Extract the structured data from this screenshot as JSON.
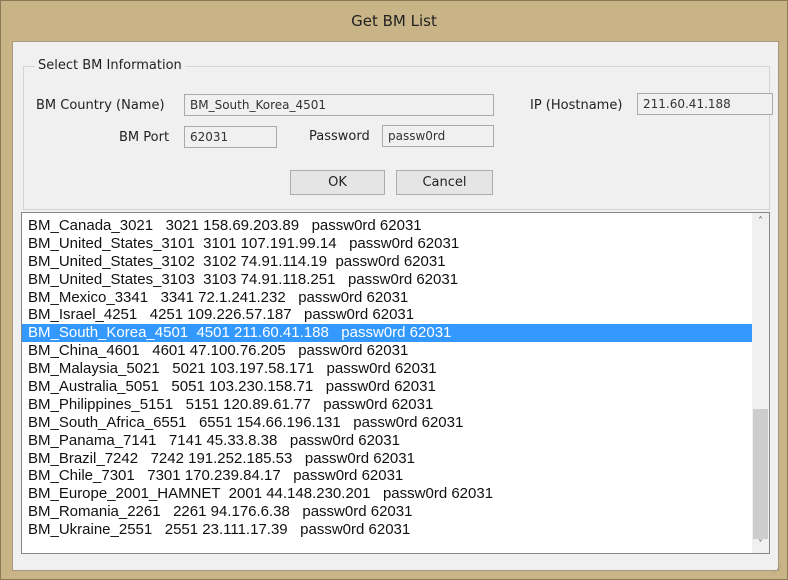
{
  "window": {
    "title": "Get BM List"
  },
  "form": {
    "group_title": "Select BM Information",
    "country_label": "BM Country (Name)",
    "country_value": "BM_South_Korea_4501",
    "ip_label": "IP (Hostname)",
    "ip_value": "211.60.41.188",
    "port_label": "BM Port",
    "port_value": "62031",
    "password_label": "Password",
    "password_value": "passw0rd",
    "ok_label": "OK",
    "cancel_label": "Cancel"
  },
  "list": {
    "selected_index": 6,
    "rows": [
      "BM_Canada_3021   3021 158.69.203.89   passw0rd 62031",
      "BM_United_States_3101  3101 107.191.99.14   passw0rd 62031",
      "BM_United_States_3102  3102 74.91.114.19  passw0rd 62031",
      "BM_United_States_3103  3103 74.91.118.251   passw0rd 62031",
      "BM_Mexico_3341   3341 72.1.241.232   passw0rd 62031",
      "BM_Israel_4251   4251 109.226.57.187   passw0rd 62031",
      "BM_South_Korea_4501  4501 211.60.41.188   passw0rd 62031",
      "BM_China_4601   4601 47.100.76.205   passw0rd 62031",
      "BM_Malaysia_5021   5021 103.197.58.171   passw0rd 62031",
      "BM_Australia_5051   5051 103.230.158.71   passw0rd 62031",
      "BM_Philippines_5151   5151 120.89.61.77   passw0rd 62031",
      "BM_South_Africa_6551   6551 154.66.196.131   passw0rd 62031",
      "BM_Panama_7141   7141 45.33.8.38   passw0rd 62031",
      "BM_Brazil_7242   7242 191.252.185.53   passw0rd 62031",
      "BM_Chile_7301   7301 170.239.84.17   passw0rd 62031",
      "BM_Europe_2001_HAMNET  2001 44.148.230.201   passw0rd 62031",
      "BM_Romania_2261   2261 94.176.6.38   passw0rd 62031",
      "BM_Ukraine_2551   2551 23.111.17.39   passw0rd 62031"
    ]
  },
  "colors": {
    "selection": "#3399ff",
    "title_bar": "#c8b486"
  },
  "icons": {
    "scroll_up": "chevron-up-icon",
    "scroll_down": "chevron-down-icon",
    "resize": "resize-grip-icon"
  }
}
